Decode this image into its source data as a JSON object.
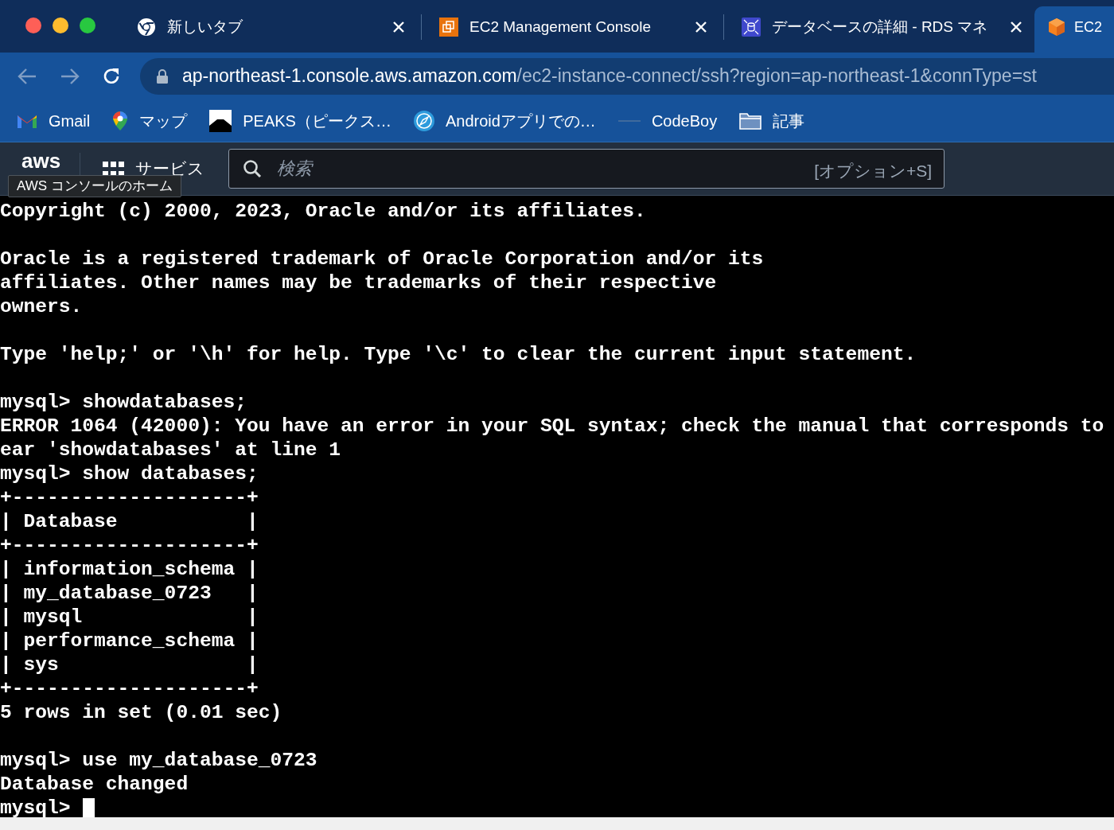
{
  "tabs": [
    {
      "kind": "chrome",
      "title": "新しいタブ",
      "selected": false
    },
    {
      "kind": "ec2",
      "title": "EC2 Management Console",
      "selected": false
    },
    {
      "kind": "rds",
      "title": "データベースの詳細 - RDS マネ",
      "selected": false
    },
    {
      "kind": "cube",
      "title": "EC2",
      "selected": true
    }
  ],
  "address": {
    "host": "ap-northeast-1.console.aws.amazon.com",
    "path": "/ec2-instance-connect/ssh?region=ap-northeast-1&connType=st"
  },
  "bookmarks": [
    {
      "kind": "gmail",
      "label": "Gmail"
    },
    {
      "kind": "maps",
      "label": "マップ"
    },
    {
      "kind": "peaks",
      "label": "PEAKS（ピークス…"
    },
    {
      "kind": "compass",
      "label": "Androidアプリでの…"
    },
    {
      "kind": "codeboy",
      "label": "CodeBoy"
    },
    {
      "kind": "folder",
      "label": "記事"
    }
  ],
  "aws_header": {
    "logo": "aws",
    "services": "サービス",
    "search_placeholder": "検索",
    "shortcut": "[オプション+S]",
    "tooltip": "AWS コンソールのホーム"
  },
  "terminal": {
    "blocks": [
      [
        "Copyright (c) 2000, 2023, Oracle and/or its affiliates."
      ],
      [
        "Oracle is a registered trademark of Oracle Corporation and/or its",
        "affiliates. Other names may be trademarks of their respective",
        "owners."
      ],
      [
        "Type 'help;' or '\\h' for help. Type '\\c' to clear the current input statement."
      ],
      [
        "mysql> showdatabases;",
        "ERROR 1064 (42000): You have an error in your SQL syntax; check the manual that corresponds to",
        "ear 'showdatabases' at line 1",
        "mysql> show databases;",
        "+--------------------+",
        "| Database           |",
        "+--------------------+",
        "| information_schema |",
        "| my_database_0723   |",
        "| mysql              |",
        "| performance_schema |",
        "| sys                |",
        "+--------------------+",
        "5 rows in set (0.01 sec)"
      ],
      [
        "mysql> use my_database_0723",
        "Database changed"
      ]
    ],
    "prompt": "mysql>"
  }
}
